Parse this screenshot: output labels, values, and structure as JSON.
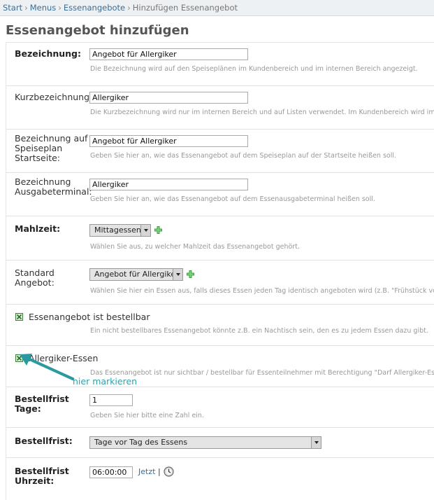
{
  "breadcrumb": {
    "items": [
      "Start",
      "Menus",
      "Essenangebote"
    ],
    "current": "Hinzufügen Essenangebot",
    "separator": "›"
  },
  "page": {
    "title": "Essenangebot hinzufügen"
  },
  "form": {
    "bezeichnung": {
      "label": "Bezeichnung:",
      "value": "Angebot für Allergiker",
      "help": "Die Bezeichnung wird auf den Speiseplänen im Kundenbereich und im internen Bereich angezeigt."
    },
    "kurzbezeichnung": {
      "label": "Kurzbezeichnung:",
      "value": "Allergiker",
      "help": "Die Kurzbezeichnung wird nur im internen Bereich und auf Listen verwendet. Im Kundenbereich wird immer"
    },
    "speiseplan": {
      "label": "Bezeichnung auf Speiseplan Startseite:",
      "value": "Angebot für Allergiker",
      "help": "Geben Sie hier an, wie das Essenangebot auf dem Speiseplan auf der Startseite heißen soll."
    },
    "ausgabeterminal": {
      "label": "Bezeichnung Ausgabeterminal:",
      "value": "Allergiker",
      "help": "Geben Sie hier an, wie das Essenangebot auf dem Essenausgabeterminal heißen soll."
    },
    "mahlzeit": {
      "label": "Mahlzeit:",
      "selected": "Mittagessen",
      "help": "Wählen Sie aus, zu welcher Mahlzeit das Essenangebot gehört."
    },
    "standard": {
      "label": "Standard Angebot:",
      "selected": "Angebot für Allergiker",
      "help": "Wählen Sie hier ein Essen aus, falls dieses Essen jeden Tag identisch angeboten wird (z.B. \"Frühstück vor"
    },
    "bestellbar": {
      "label": "Essenangebot ist bestellbar",
      "checked": true,
      "help": "Ein nicht bestellbares Essenangebot könnte z.B. ein Nachtisch sein, den es zu jedem Essen dazu gibt."
    },
    "allergiker": {
      "label": "Allergiker-Essen",
      "checked": true,
      "help": "Das Essenangebot ist nur sichtbar / bestellbar für Essenteilnehmer mit Berechtigung \"Darf Allergiker-Essen"
    },
    "bestellfrist_tage": {
      "label": "Bestellfrist Tage:",
      "value": "1",
      "help": "Geben Sie hier bitte eine Zahl ein."
    },
    "bestellfrist": {
      "label": "Bestellfrist:",
      "selected": "Tage vor Tag des Essens"
    },
    "bestellfrist_uhrzeit": {
      "label": "Bestellfrist Uhrzeit:",
      "value": "06:00:00",
      "now_link": "Jetzt",
      "divider": "|"
    }
  },
  "annotation": {
    "text": "hier markieren",
    "color": "#2fa2a8"
  },
  "colors": {
    "link": "#3b6d96",
    "plus": "#3aa33a",
    "checkbox": "#3f7d3f"
  }
}
